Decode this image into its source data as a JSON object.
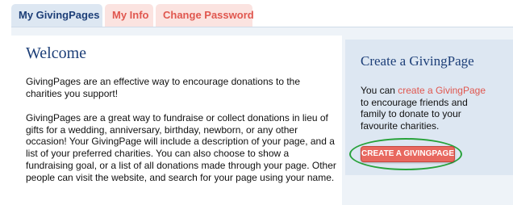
{
  "tabs": [
    {
      "label": "My GivingPages",
      "active": true
    },
    {
      "label": "My Info",
      "active": false
    },
    {
      "label": "Change Password",
      "active": false
    }
  ],
  "main": {
    "title": "Welcome",
    "paragraphs": [
      "GivingPages are an effective way to encourage donations to the charities you support!",
      "GivingPages are a great way to fundraise or collect donations in lieu of gifts for a wedding, anniversary, birthday, newborn, or any other occasion! Your GivingPage will include a description of your page, and a list of your preferred charities. You can also choose to show a fundraising goal, or a list of all donations made through your page. Other people can visit the website, and search for your page using your name."
    ]
  },
  "sidebar": {
    "title": "Create a GivingPage",
    "text_before": "You can ",
    "link_text": "create a GivingPage",
    "text_after": " to encourage friends and family to donate to your favourite charities.",
    "button_label": "CREATE A GIVINGPAGE"
  },
  "colors": {
    "accent_blue": "#1d3f78",
    "link_red": "#e0574f",
    "button_red": "#e8685f",
    "highlight_green": "#27a23a",
    "panel_blue": "#dde7f2"
  }
}
